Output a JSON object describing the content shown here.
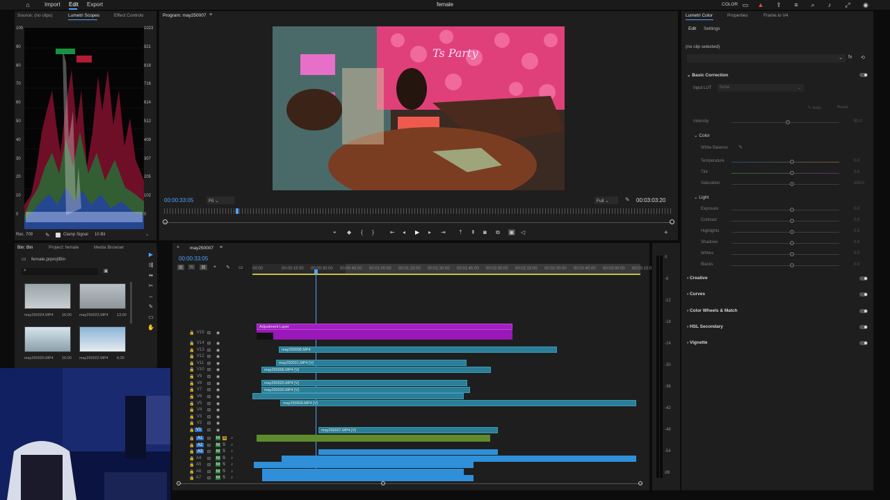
{
  "app": {
    "title": "female",
    "menu": [
      "Import",
      "Edit",
      "Export"
    ],
    "active_menu": "Edit",
    "workspace_label": "COLOR"
  },
  "source_panel": {
    "tabs": [
      "Source: (no clips)",
      "Lumetri Scopes",
      "Effect Controls"
    ],
    "active_tab": "Lumetri Scopes",
    "scale_left": [
      "100",
      "90",
      "80",
      "70",
      "60",
      "50",
      "40",
      "30",
      "20",
      "10",
      "0"
    ],
    "scale_right": [
      "1023",
      "921",
      "818",
      "716",
      "614",
      "512",
      "409",
      "307",
      "205",
      "102",
      "0"
    ],
    "footer": {
      "colorspace": "Rec. 709",
      "clamp_label": "Clamp Signal",
      "bit_depth": "10 Bit"
    }
  },
  "program": {
    "title": "Program: may250007",
    "timecode": "00:00:33:05",
    "fit": "Fit",
    "quality": "Full",
    "duration": "00:03:03:20",
    "neon_text": "Ts Party"
  },
  "lumetri": {
    "tabs": [
      "Lumetri Color",
      "Properties",
      "Frame.io V4"
    ],
    "active_tab": "Lumetri Color",
    "subtabs": [
      "Edit",
      "Settings"
    ],
    "clip_status": "(no clip selected)",
    "basic_correction": "Basic Correction",
    "input_lut_label": "Input LUT",
    "input_lut_value": "None",
    "auto": "Auto",
    "reset": "Reset",
    "intensity_label": "Intensity",
    "intensity_value": "50.0",
    "color_label": "Color",
    "white_balance": "White Balance",
    "color_rows": [
      {
        "label": "Temperature",
        "value": "0.0"
      },
      {
        "label": "Tint",
        "value": "0.0"
      },
      {
        "label": "Saturation",
        "value": "100.0"
      }
    ],
    "light_label": "Light",
    "light_rows": [
      {
        "label": "Exposure",
        "value": "0.0"
      },
      {
        "label": "Contrast",
        "value": "0.0"
      },
      {
        "label": "Highlights",
        "value": "0.0"
      },
      {
        "label": "Shadows",
        "value": "0.0"
      },
      {
        "label": "Whites",
        "value": "0.0"
      },
      {
        "label": "Blacks",
        "value": "0.0"
      }
    ],
    "sections": [
      "Creative",
      "Curves",
      "Color Wheels & Match",
      "HSL Secondary",
      "Vignette"
    ]
  },
  "project_panel": {
    "tabs": [
      "Bin: Bin",
      "Project: female",
      "Media Browser"
    ],
    "bin_path": "female.prproj\\Bin",
    "items": [
      {
        "name": "may250024.MP4",
        "duration": "16;00"
      },
      {
        "name": "may250023.MP4",
        "duration": "13;00"
      },
      {
        "name": "may250020.MP4",
        "duration": "16;00"
      },
      {
        "name": "may250022.MP4",
        "duration": "6;30"
      }
    ]
  },
  "timeline": {
    "sequence": "may250007",
    "timecode": "00:00:33:05",
    "ruler": [
      "00:00",
      "00:00:15:00",
      "00:00:30:00",
      "00:00:45:00",
      "00:01:00:00",
      "00:01:15:00",
      "00:01:30:00",
      "00:01:45:00",
      "00:02:00:00",
      "00:02:15:00",
      "00:02:30:00",
      "00:02:45:00",
      "00:03:00:00",
      "00:03:15:0"
    ],
    "video_tracks": [
      "V15",
      "V14",
      "V13",
      "V12",
      "V11",
      "V10",
      "V9",
      "V8",
      "V7",
      "V6",
      "V5",
      "V4",
      "V3",
      "V2",
      "V1"
    ],
    "audio_tracks": [
      "A1",
      "A2",
      "A3",
      "A4",
      "A5",
      "A6",
      "A7"
    ],
    "clips": {
      "adjustment": "Adjustment Layer",
      "v14": "may250008.MP4",
      "v12": "may250031.MP4 [V]",
      "v11": "may250006.MP4 [V]",
      "v9": "may250025.MP4 [V]",
      "v8": "may250030.MP4 [V]",
      "v7": "may250029.MP4 [V]",
      "v6": "may250009.MP4 [V]",
      "v1": "may250007.MP4 [V]"
    }
  },
  "meter_scale": [
    "0",
    "-6",
    "-12",
    "-18",
    "-24",
    "-30",
    "-36",
    "-42",
    "-48",
    "-54",
    "dB"
  ]
}
